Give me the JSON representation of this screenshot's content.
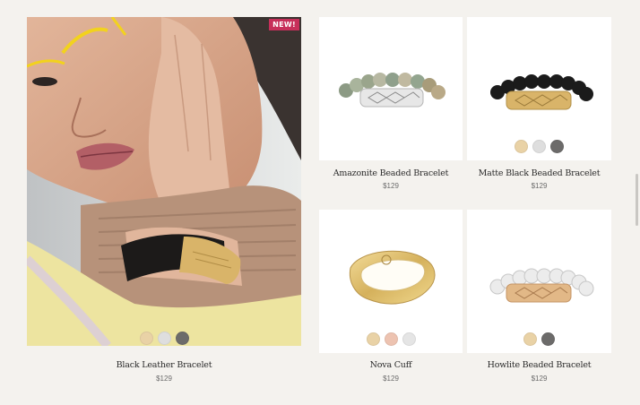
{
  "featured": {
    "badge": "NEW!",
    "name": "Black Leather Bracelet",
    "price": "$129",
    "swatches": [
      "#e9d2a6",
      "#dedede",
      "#6c6b6a"
    ]
  },
  "products": [
    {
      "name": "Amazonite Beaded Bracelet",
      "price": "$129",
      "swatches": []
    },
    {
      "name": "Matte Black Beaded Bracelet",
      "price": "$129",
      "swatches": [
        "#e9d2a6",
        "#dedede",
        "#6c6b6a"
      ]
    },
    {
      "name": "Nova Cuff",
      "price": "$129",
      "swatches": [
        "#e9d2a6",
        "#edc3b1",
        "#e5e5e5"
      ]
    },
    {
      "name": "Howlite Beaded Bracelet",
      "price": "$129",
      "swatches": [
        "#e9d2a6",
        "#6c6b6a"
      ]
    }
  ],
  "colors": {
    "background": "#f4f2ee",
    "badge": "#c72f5a",
    "gold": "#d9b469",
    "silver": "#c9c9c9"
  }
}
